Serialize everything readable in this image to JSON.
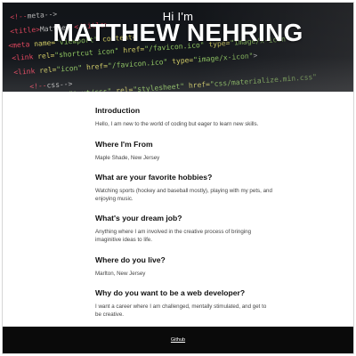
{
  "hero": {
    "greeting": "Hi I'm",
    "name": "MATTHEW NEHRING"
  },
  "sections": [
    {
      "heading": "Introduction",
      "body": "Hello, I am new to the world of coding but eager to learn new skills."
    },
    {
      "heading": "Where I'm From",
      "body": "Maple Shade, New Jersey"
    },
    {
      "heading": "What are your favorite hobbies?",
      "body": "Watching sports (hockey and baseball mostly), playing with my pets, and enjoying music."
    },
    {
      "heading": "What's your dream job?",
      "body": "Anything where I am involved in the creative process of bringing imaginitive ideas to life."
    },
    {
      "heading": "Where do you live?",
      "body": "Marlton, New Jersey"
    },
    {
      "heading": "Why do you want to be a web developer?",
      "body": "I want a career where I am challenged, mentally stimulated, and get to be creative."
    }
  ],
  "footer": {
    "link_label": "Github"
  },
  "colors": {
    "hero_bg": "#15181d",
    "footer_bg": "#0a0a0a",
    "heading": "#111111",
    "body_text": "#444444"
  }
}
